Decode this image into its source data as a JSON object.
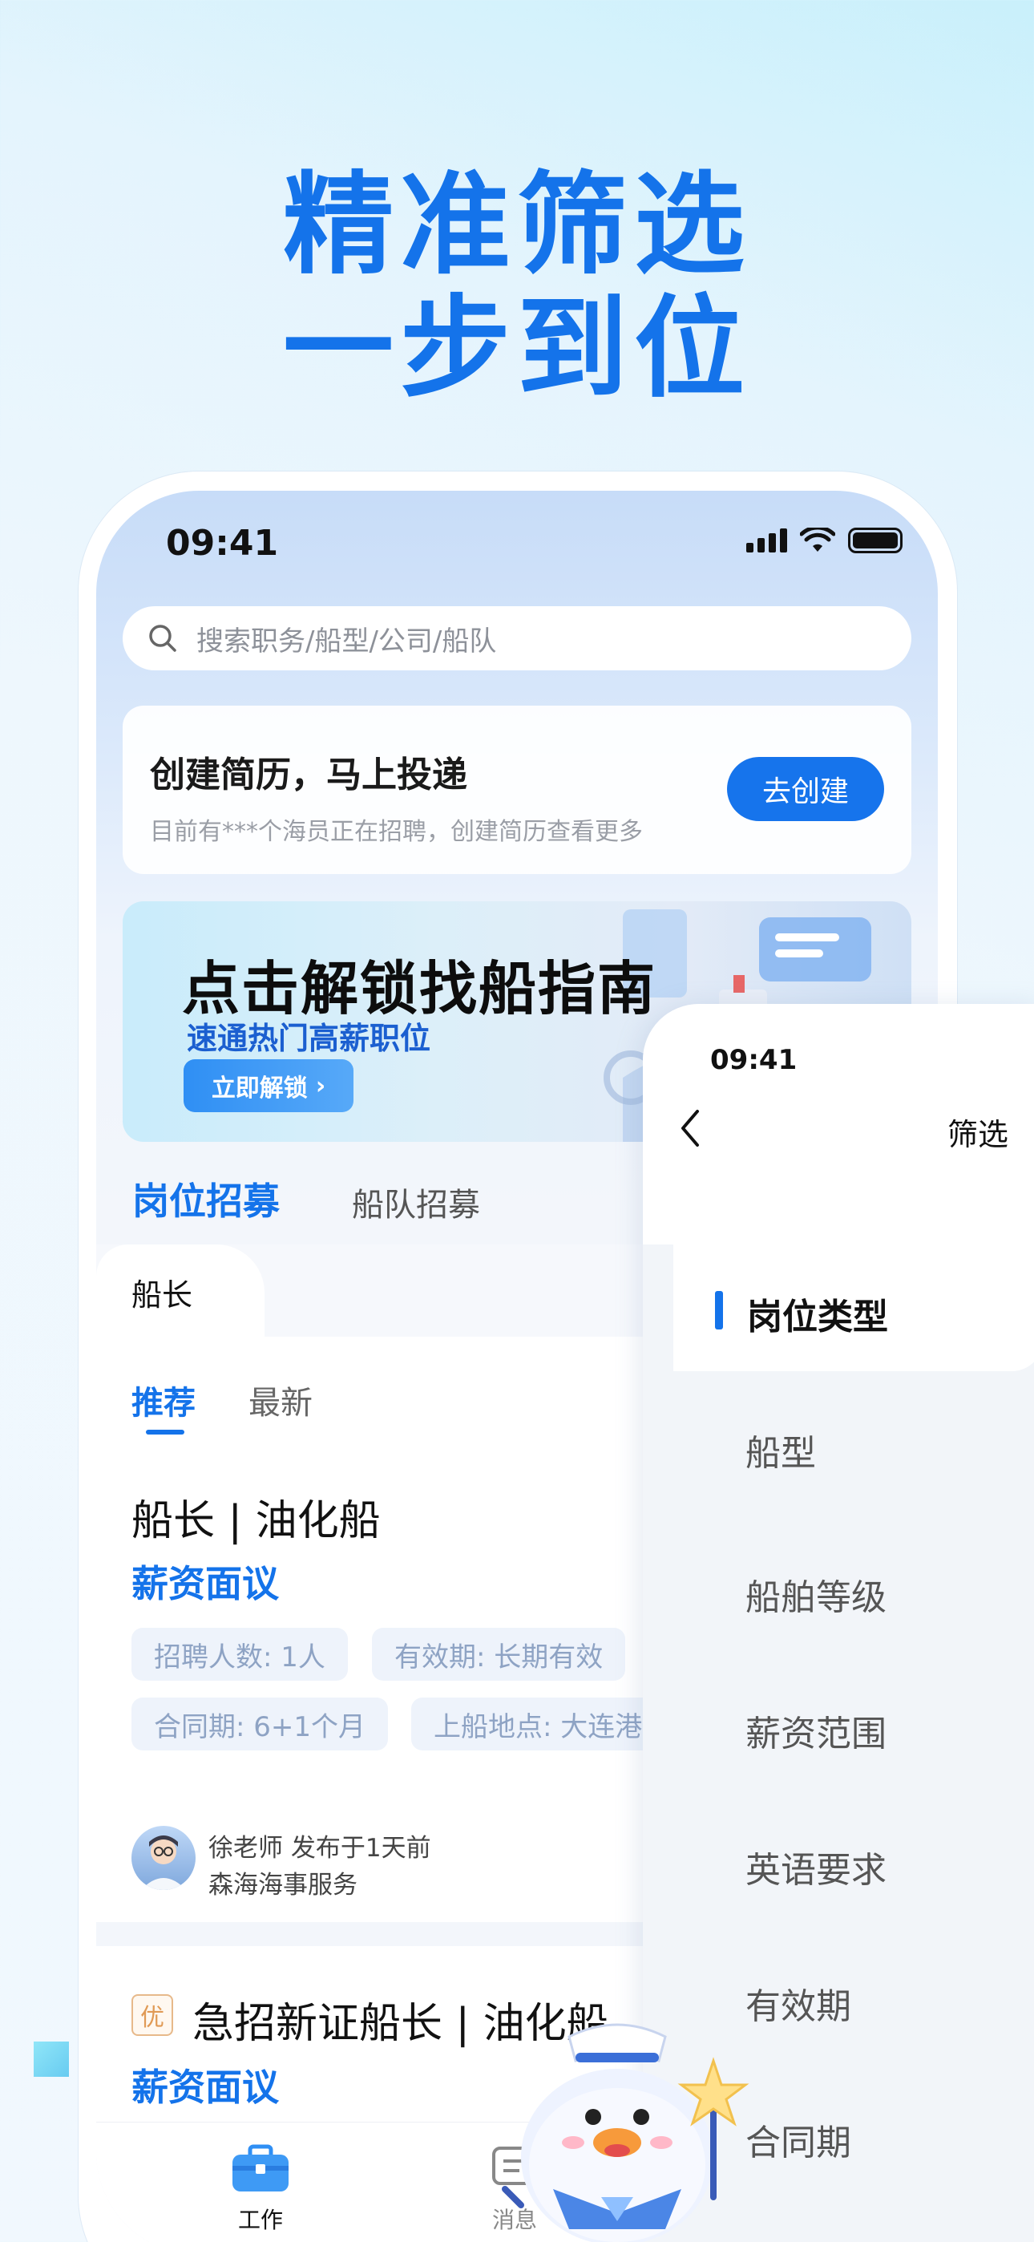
{
  "headline": {
    "line1": "精准筛选",
    "line2": "一步到位"
  },
  "status_bar": {
    "time": "09:41"
  },
  "search": {
    "placeholder": "搜索职务/船型/公司/船队"
  },
  "resume_card": {
    "title": "创建简历，马上投递",
    "subtitle": "目前有***个海员正在招聘，创建简历查看更多",
    "button": "去创建"
  },
  "banner": {
    "title": "点击解锁找船指南",
    "subtitle": "速通热门高薪职位",
    "button": "立即解锁"
  },
  "tabs": [
    {
      "label": "岗位招募"
    },
    {
      "label": "船队招募"
    }
  ],
  "position_chip": "船长",
  "sub_tabs": [
    {
      "label": "推荐"
    },
    {
      "label": "最新"
    }
  ],
  "job1": {
    "title": "船长 | 油化船",
    "salary": "薪资面议",
    "tags": [
      "招聘人数: 1人",
      "有效期: 长期有效",
      "合同期: 6+1个月",
      "上船地点: 大连港"
    ],
    "poster": "徐老师  发布于1天前",
    "company": "森海海事服务"
  },
  "job2": {
    "badge": "优",
    "title": "急招新证船长 | 油化船",
    "salary": "薪资面议"
  },
  "tabbar": [
    {
      "label": "工作",
      "icon": "briefcase-icon"
    },
    {
      "label": "消息",
      "icon": "message-icon"
    }
  ],
  "filter_panel": {
    "time": "09:41",
    "title": "筛选",
    "active_category": "岗位类型",
    "categories": [
      "船型",
      "船舶等级",
      "薪资范围",
      "英语要求",
      "有效期",
      "合同期"
    ]
  },
  "colors": {
    "accent": "#1473ea",
    "button": "#1674ec",
    "tag_bg": "#eef3fb",
    "tag_text": "#8ea3c4"
  }
}
